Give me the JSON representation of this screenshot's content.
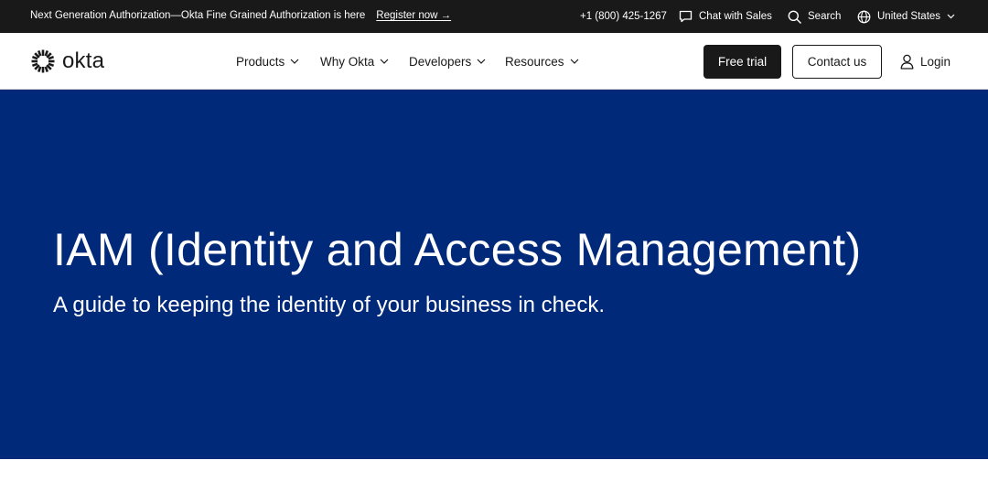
{
  "announcement": {
    "text": "Next Generation Authorization—Okta Fine Grained Authorization is here",
    "link_label": "Register now →"
  },
  "utility": {
    "phone": "+1 (800) 425-1267",
    "chat_label": "Chat with Sales",
    "search_label": "Search",
    "region_label": "United States"
  },
  "brand": {
    "name": "okta",
    "color": "#191919"
  },
  "nav": {
    "items": [
      {
        "label": "Products"
      },
      {
        "label": "Why Okta"
      },
      {
        "label": "Developers"
      },
      {
        "label": "Resources"
      }
    ],
    "free_trial_label": "Free trial",
    "contact_label": "Contact us",
    "login_label": "Login"
  },
  "hero": {
    "title": "IAM (Identity and Access Management)",
    "subtitle": "A guide to keeping the identity of your business in check.",
    "background_color": "#00297a"
  },
  "icons": {
    "chat": "chat-bubble-icon",
    "search": "search-icon",
    "region": "globe-icon",
    "dropdown": "chevron-down-icon",
    "login": "user-icon",
    "logo": "okta-sunburst-icon"
  }
}
